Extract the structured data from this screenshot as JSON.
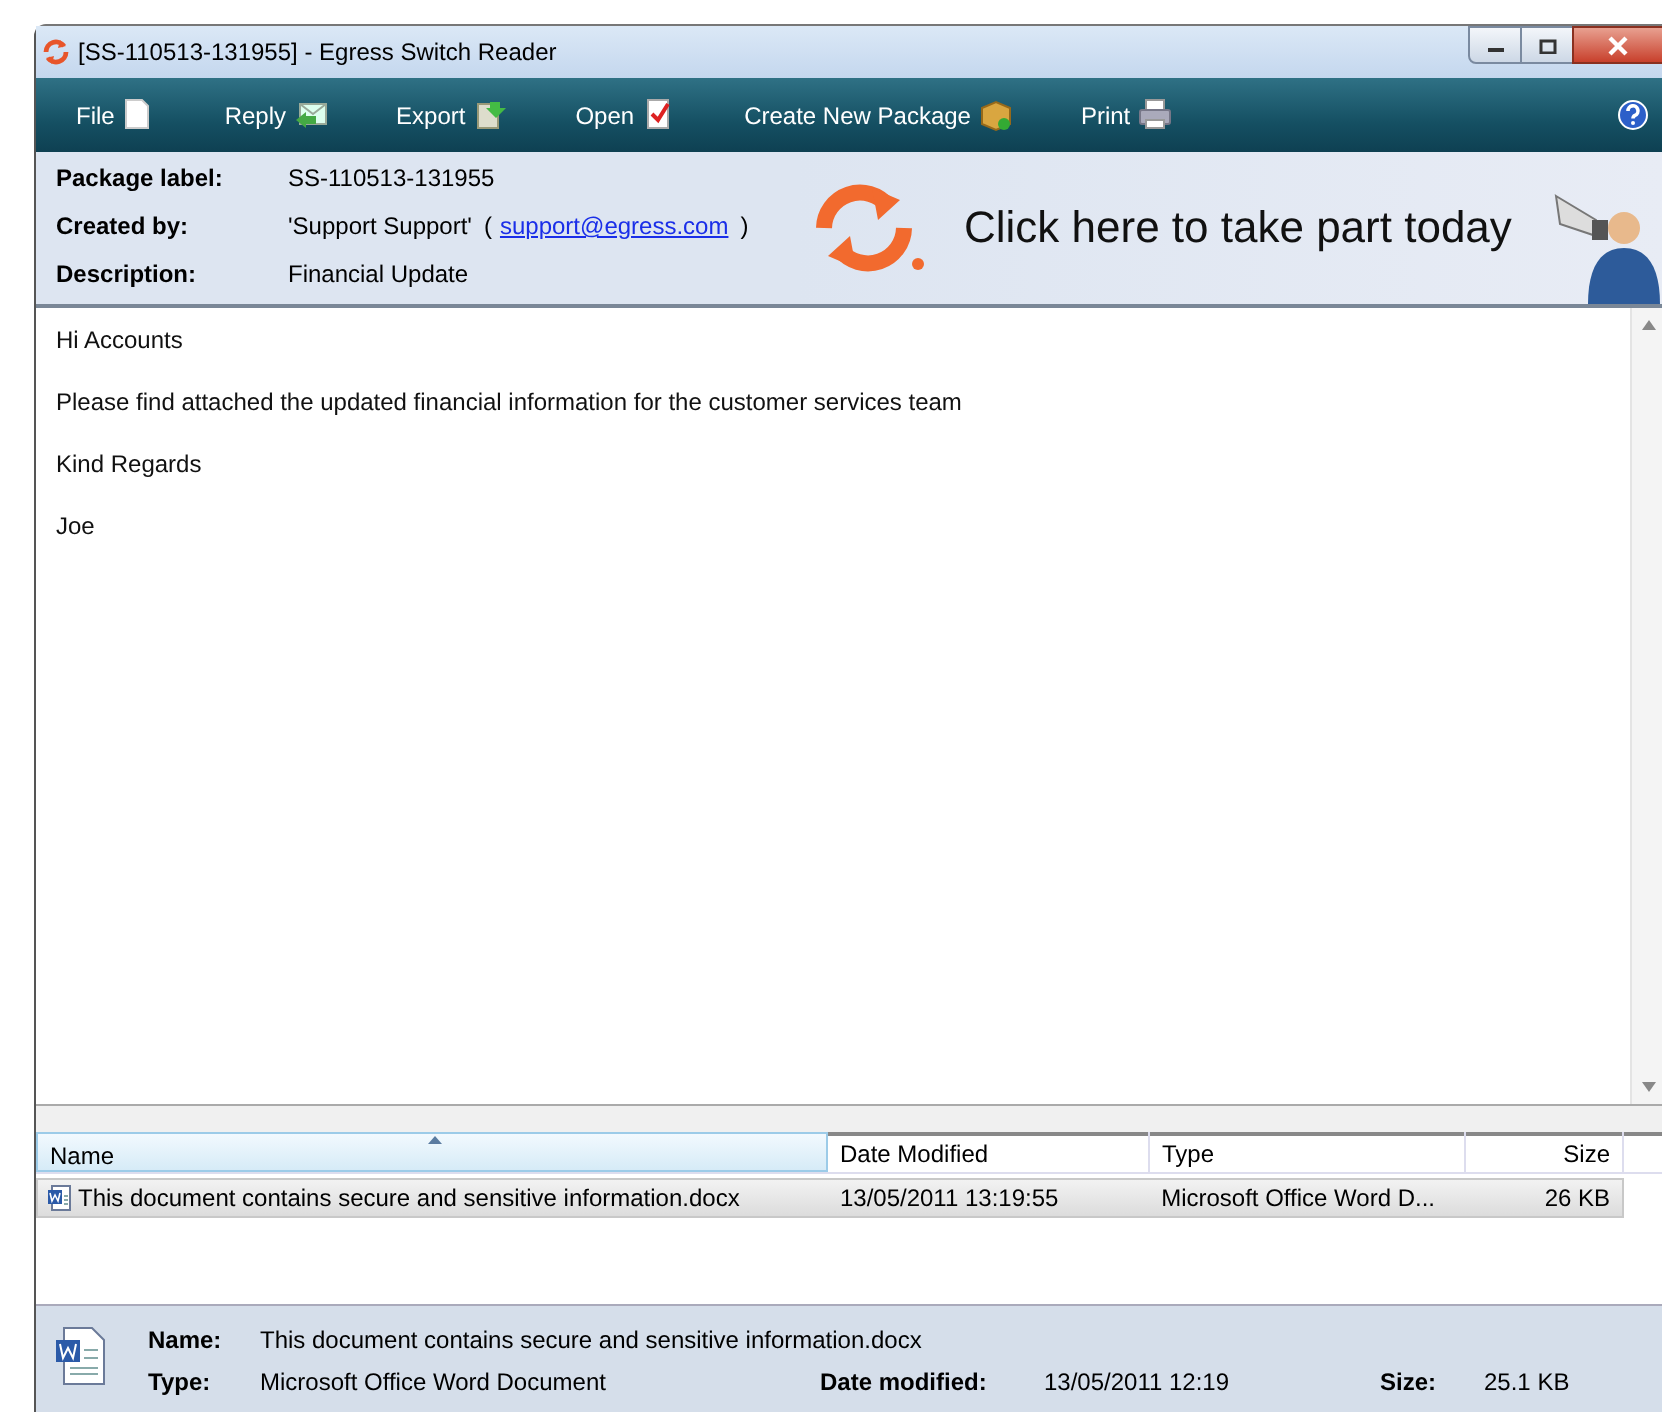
{
  "window": {
    "title": "[SS-110513-131955] - Egress Switch Reader"
  },
  "toolbar": [
    {
      "label": "File",
      "kind": "file"
    },
    {
      "label": "Reply",
      "kind": "reply"
    },
    {
      "label": "Export",
      "kind": "export"
    },
    {
      "label": "Open",
      "kind": "open"
    },
    {
      "label": "Create New Package",
      "kind": "package"
    },
    {
      "label": "Print",
      "kind": "print"
    }
  ],
  "header": {
    "fields": [
      {
        "label": "Package label:",
        "value": "SS-110513-131955"
      },
      {
        "label": "Created by:",
        "value": "'Support Support'",
        "open": "(",
        "link": "support@egress.com",
        "close": ")"
      },
      {
        "label": "Description:",
        "value": "Financial Update"
      }
    ],
    "banner": "Click here to take part today"
  },
  "message": [
    "Hi Accounts",
    "Please find attached the updated financial information for the customer services team",
    "Kind Regards",
    "Joe"
  ],
  "files": {
    "columns": [
      {
        "label": "Name",
        "sorted": true
      },
      {
        "label": "Date Modified",
        "sorted": false
      },
      {
        "label": "Type",
        "sorted": false
      },
      {
        "label": "Size",
        "sorted": false
      }
    ],
    "rows": [
      {
        "cells": [
          "This document contains secure and sensitive information.docx",
          "13/05/2011 13:19:55",
          "Microsoft Office Word D...",
          "26 KB"
        ],
        "selected": true
      }
    ]
  },
  "details": {
    "name_label": "Name:",
    "name": "This document contains secure and sensitive information.docx",
    "type_label": "Type:",
    "type": "Microsoft Office Word Document",
    "date_label": "Date modified:",
    "date": "13/05/2011 12:19",
    "size_label": "Size:",
    "size": "25.1 KB"
  }
}
